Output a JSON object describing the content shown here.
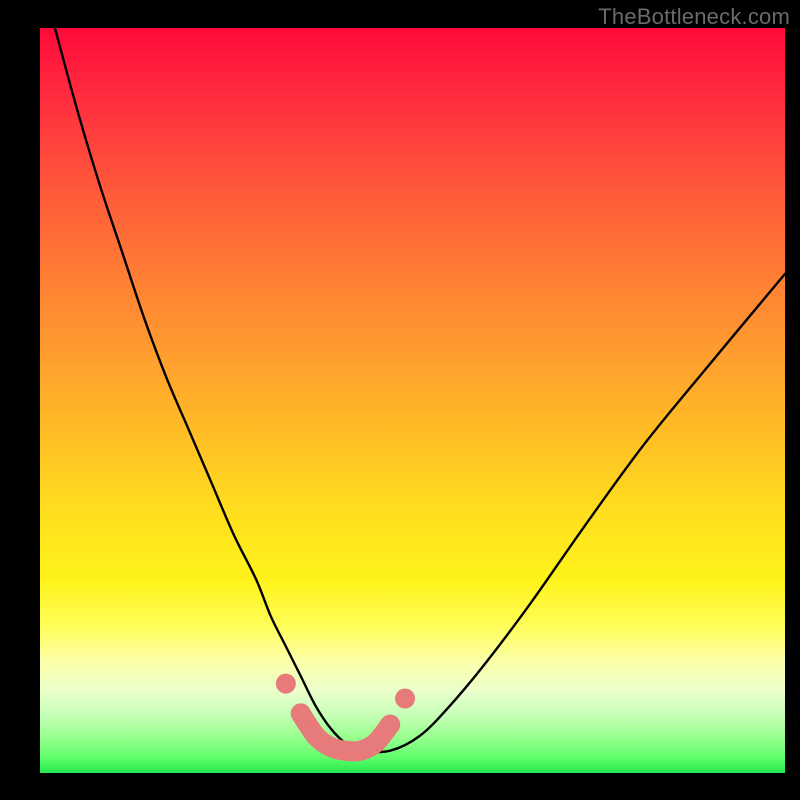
{
  "watermark": "TheBottleneck.com",
  "chart_data": {
    "type": "line",
    "title": "",
    "xlabel": "",
    "ylabel": "",
    "xlim": [
      0,
      100
    ],
    "ylim": [
      0,
      100
    ],
    "series": [
      {
        "name": "bottleneck-curve",
        "x": [
          2,
          5,
          8,
          11,
          14,
          17,
          20,
          23,
          26,
          29,
          31,
          33,
          35,
          37,
          39,
          41,
          43,
          47,
          51,
          55,
          60,
          66,
          73,
          81,
          90,
          100
        ],
        "values": [
          100,
          89,
          79,
          70,
          61,
          53,
          46,
          39,
          32,
          26,
          21,
          17,
          13,
          9,
          6,
          4,
          3,
          3,
          5,
          9,
          15,
          23,
          33,
          44,
          55,
          67
        ]
      },
      {
        "name": "highlight-dots",
        "x": [
          33,
          35,
          37,
          39,
          41,
          43,
          45,
          47,
          49
        ],
        "values": [
          12,
          8,
          5,
          3.5,
          3,
          3,
          4,
          6.5,
          10
        ]
      }
    ],
    "colors": {
      "curve": "#000000",
      "dots": "#e77b7b"
    }
  }
}
